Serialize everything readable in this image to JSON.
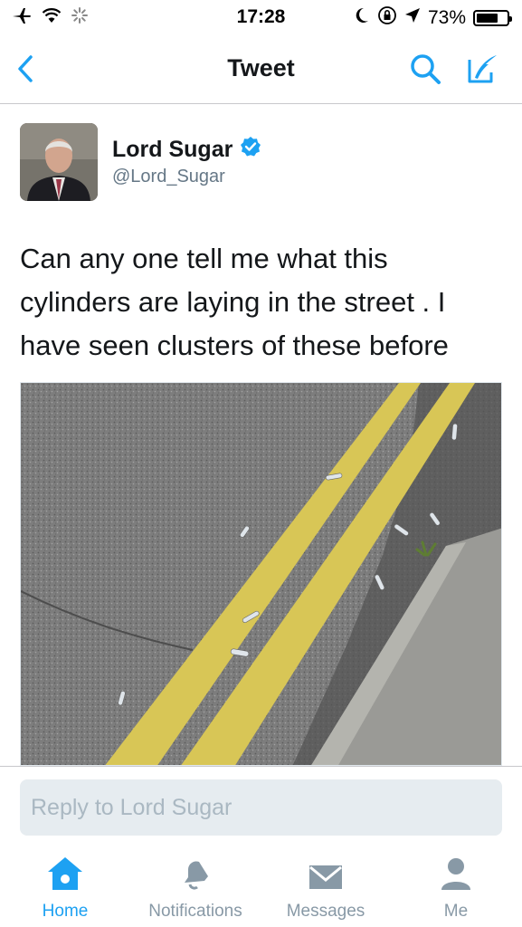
{
  "status_bar": {
    "time": "17:28",
    "battery_text": "73%",
    "battery_level": 0.73,
    "icons": [
      "airplane-icon",
      "wifi-icon",
      "activity-spinner-icon",
      "moon-icon",
      "rotation-lock-icon",
      "location-arrow-icon",
      "battery-icon"
    ]
  },
  "nav": {
    "title": "Tweet",
    "back_icon": "chevron-left-icon",
    "search_icon": "search-icon",
    "compose_icon": "compose-icon"
  },
  "tweet": {
    "author_name": "Lord Sugar",
    "verified": true,
    "handle": "@Lord_Sugar",
    "text": "Can any one tell me what this\ncylinders are  laying in the street . I\nhave seen clusters of these before"
  },
  "reply": {
    "placeholder": "Reply to Lord Sugar"
  },
  "tabs": [
    {
      "label": "Home",
      "icon": "home-icon",
      "active": true
    },
    {
      "label": "Notifications",
      "icon": "bell-icon",
      "active": false
    },
    {
      "label": "Messages",
      "icon": "envelope-icon",
      "active": false
    },
    {
      "label": "Me",
      "icon": "person-icon",
      "active": false
    }
  ],
  "colors": {
    "accent": "#1da1f2",
    "inactive": "#8899a6",
    "handle": "#657786"
  }
}
